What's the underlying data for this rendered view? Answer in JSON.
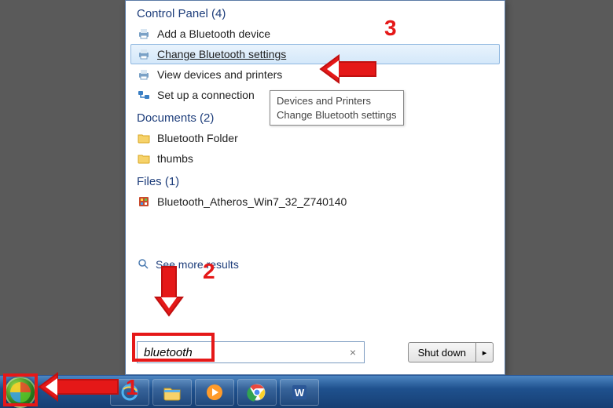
{
  "sections": {
    "control_panel": {
      "header": "Control Panel (4)"
    },
    "documents": {
      "header": "Documents (2)"
    },
    "files": {
      "header": "Files (1)"
    }
  },
  "control_panel_items": [
    {
      "label": "Add a Bluetooth device"
    },
    {
      "label": "Change Bluetooth settings"
    },
    {
      "label": "View devices and printers"
    },
    {
      "label": "Set up a connection"
    }
  ],
  "document_items": [
    {
      "label": "Bluetooth Folder"
    },
    {
      "label": "thumbs"
    }
  ],
  "file_items": [
    {
      "label": "Bluetooth_Atheros_Win7_32_Z740140"
    }
  ],
  "tooltip": {
    "line1": "Devices and Printers",
    "line2": "Change Bluetooth settings"
  },
  "see_more": {
    "label": "See more results"
  },
  "search": {
    "value": "bluetooth",
    "clear": "×"
  },
  "shutdown": {
    "label": "Shut down",
    "chevron": "▸"
  },
  "annotations": {
    "n1": "1",
    "n2": "2",
    "n3": "3"
  }
}
